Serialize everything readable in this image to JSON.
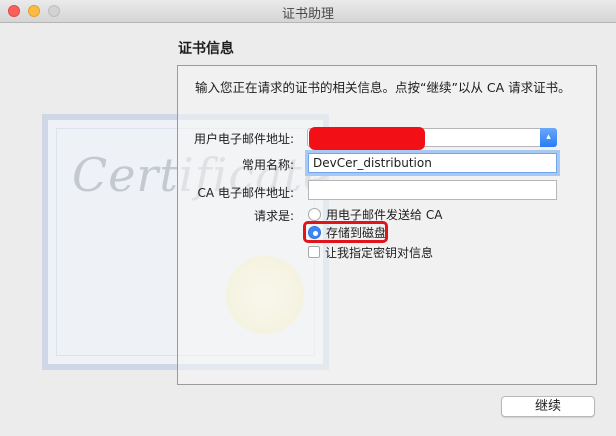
{
  "window": {
    "title": "证书助理"
  },
  "section_title": "证书信息",
  "intro": "输入您正在请求的证书的相关信息。点按“继续”以从 CA 请求证书。",
  "background_art": {
    "word": "Certificate"
  },
  "form": {
    "email_label": "用户电子邮件地址:",
    "email_value": "",
    "common_name_label": "常用名称:",
    "common_name_value": "DevCer_distribution",
    "ca_email_label": "CA 电子邮件地址:",
    "ca_email_value": "",
    "request_label": "请求是:",
    "options": [
      {
        "label": "用电子邮件发送给 CA",
        "selected": false
      },
      {
        "label": "存储到磁盘",
        "selected": true
      }
    ],
    "key_pair_label": "让我指定密钥对信息",
    "key_pair_checked": false
  },
  "buttons": {
    "continue": "继续"
  },
  "colors": {
    "highlight": "#e0141a",
    "redaction": "#f20f16",
    "accent": "#3c87f4"
  }
}
